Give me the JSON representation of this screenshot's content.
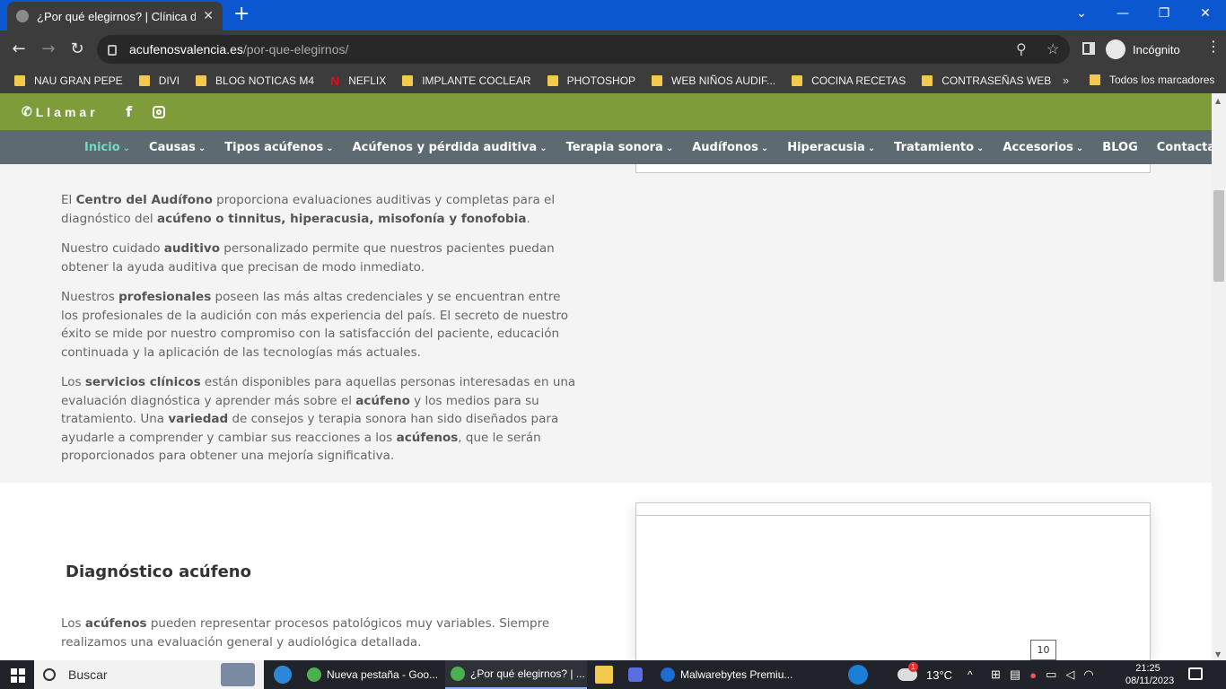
{
  "browser": {
    "tab_title": "¿Por qué elegirnos? | Clínica del",
    "tab_close": "✕",
    "new_tab": "+",
    "url_host": "acufenosvalencia.es",
    "url_path": "/por-que-elegirnos/",
    "incognito_label": "Incógnito",
    "bookmarks": [
      "NAU GRAN PEPE",
      "DIVI",
      "BLOG NOTICAS M4",
      "NEFLIX",
      "IMPLANTE COCLEAR",
      "PHOTOSHOP",
      "WEB NIÑOS AUDIF...",
      "COCINA RECETAS",
      "CONTRASEÑAS WEB"
    ],
    "bookmarks_more": "»",
    "all_bookmarks": "Todos los marcadores"
  },
  "site": {
    "call_label": "Llamar",
    "nav": [
      {
        "label": "Inicio",
        "has_dropdown": true,
        "active": true
      },
      {
        "label": "Causas",
        "has_dropdown": true
      },
      {
        "label": "Tipos acúfenos",
        "has_dropdown": true
      },
      {
        "label": "Acúfenos y pérdida auditiva",
        "has_dropdown": true
      },
      {
        "label": "Terapia sonora",
        "has_dropdown": true
      },
      {
        "label": "Audífonos",
        "has_dropdown": true
      },
      {
        "label": "Hiperacusia",
        "has_dropdown": true
      },
      {
        "label": "Tratamiento",
        "has_dropdown": true
      },
      {
        "label": "Accesorios",
        "has_dropdown": true
      },
      {
        "label": "BLOG",
        "has_dropdown": false
      },
      {
        "label": "Contactar",
        "has_dropdown": false
      }
    ],
    "section1": {
      "p1": [
        {
          "t": "El "
        },
        {
          "b": "Centro del Audífono"
        },
        {
          "t": " proporciona evaluaciones auditivas y completas para el diagnóstico del "
        },
        {
          "b": "acúfeno o tinnitus, hiperacusia, misofonía y fonofobia"
        },
        {
          "t": "."
        }
      ],
      "p2": [
        {
          "t": "Nuestro cuidado "
        },
        {
          "b": "auditivo"
        },
        {
          "t": " personalizado permite que nuestros pacientes puedan obtener la ayuda auditiva que precisan de modo inmediato."
        }
      ],
      "p3": [
        {
          "t": "Nuestros "
        },
        {
          "b": "profesionales"
        },
        {
          "t": " poseen las más altas credenciales y se encuentran entre los profesionales de la audición con más experiencia del país. El secreto de nuestro éxito se mide por nuestro compromiso con la satisfacción del paciente, educación continuada y la aplicación de las tecnologías más actuales."
        }
      ],
      "p4": [
        {
          "t": "Los "
        },
        {
          "b": "servicios clínicos"
        },
        {
          "t": " están disponibles para aquellas personas interesadas en una evaluación diagnóstica y aprender más sobre el "
        },
        {
          "b": "acúfeno"
        },
        {
          "t": " y los medios para su tratamiento. Una "
        },
        {
          "b": "variedad"
        },
        {
          "t": " de consejos y terapia sonora han sido diseñados para ayudarle a comprender y cambiar sus reacciones a los "
        },
        {
          "b": "acúfenos"
        },
        {
          "t": ", que le serán proporcionados para obtener una mejoría significativa."
        }
      ]
    },
    "section2": {
      "heading": "Diagnóstico acúfeno",
      "p1": [
        {
          "t": "Los "
        },
        {
          "b": "acúfenos"
        },
        {
          "t": " pueden representar procesos patológicos muy variables. Siempre realizamos una evaluación general y audiológica detallada."
        }
      ],
      "badge": "10"
    }
  },
  "taskbar": {
    "search_label": "Buscar",
    "apps": [
      {
        "label": "Nueva pestaña - Goo...",
        "color": "#4caf50"
      },
      {
        "label": "¿Por qué elegirnos? | ...",
        "color": "#4caf50",
        "active": true
      },
      {
        "label": "Malwarebytes Premiu...",
        "color": "#1c6dd0"
      }
    ],
    "temperature": "13°C",
    "weather_badge": "1",
    "time": "21:25",
    "date": "08/11/2023"
  },
  "icons": {
    "back": "back-arrow-icon",
    "forward": "forward-arrow-icon",
    "reload": "reload-icon",
    "phone": "phone-icon",
    "facebook": "facebook-icon",
    "instagram": "instagram-icon"
  }
}
